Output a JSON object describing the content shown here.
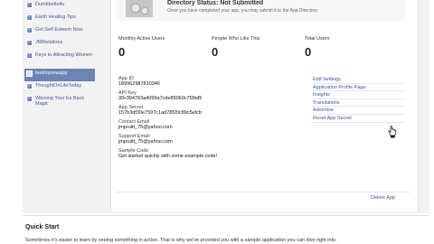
{
  "sidebar": {
    "items": [
      {
        "label": "Dumbbells4u"
      },
      {
        "label": "Earth Healing Tips"
      },
      {
        "label": "Get Self Esteem Now"
      },
      {
        "label": "JMRelations"
      },
      {
        "label": "Keys to Attracting Women"
      },
      {
        "label": "testmynewapp"
      },
      {
        "label": "ThoughtOnLifeToday"
      },
      {
        "label": "Winning Your Ex Back Magic"
      }
    ]
  },
  "status": {
    "title": "Directory Status: Not Submitted",
    "subtitle": "Once you have completed your app, you may submit it to the App Directory."
  },
  "stats": [
    {
      "label": "Monthly Active Users",
      "value": "0"
    },
    {
      "label": "People Who Like This",
      "value": "0"
    },
    {
      "label": "Total Users",
      "value": "0"
    }
  ],
  "fields": [
    {
      "label": "App ID",
      "value": "189962987810346"
    },
    {
      "label": "API Key",
      "value": "30c394763a4099a7cde89060c7f2bd5"
    },
    {
      "label": "App Secret",
      "value": "157b3df30e7597c1ad78f20c89c5efcb"
    },
    {
      "label": "Contact Email",
      "value": "jmpruitt_75@yahoo.com"
    },
    {
      "label": "Support Email",
      "value": "jmpruitt_75@yahoo.com"
    },
    {
      "label": "Sample Code",
      "value": "Get started quickly with some example code!"
    }
  ],
  "links": [
    {
      "label": "Edit Settings"
    },
    {
      "label": "Application Profile Page"
    },
    {
      "label": "Insights"
    },
    {
      "label": "Translations"
    },
    {
      "label": "Advertise"
    },
    {
      "label": "Reset App Secret"
    }
  ],
  "delete_label": "Delete App",
  "quick_start": {
    "title": "Quick Start",
    "text": "Sometimes it's easier to learn by seeing something in action. That is why we've provided you with a sample application you can dive right into."
  },
  "colors": {
    "link": "#3b5998",
    "active": "#6d84b4"
  }
}
